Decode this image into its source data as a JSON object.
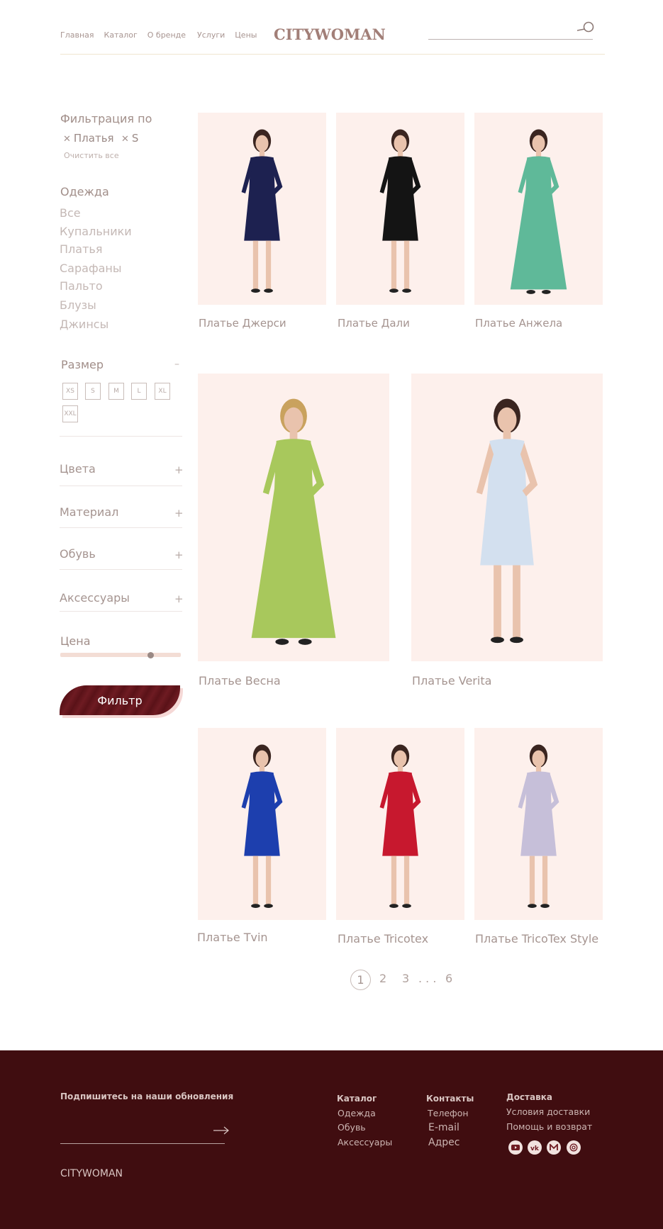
{
  "header": {
    "nav": [
      "Главная",
      "Каталог",
      "О бренде",
      "Услуги",
      "Цены"
    ],
    "logo": "CITYWOMAN"
  },
  "sidebar": {
    "filter_title": "Фильтрация по",
    "active_filters": [
      "Платья",
      "S"
    ],
    "clear_all": "Очистить все",
    "clothing_title": "Одежда",
    "clothing_items": [
      "Все",
      "Купальники",
      "Платья",
      "Сарафаны",
      "Пальто",
      "Блузы",
      "Джинсы"
    ],
    "size_title": "Размер",
    "sizes": [
      "XS",
      "S",
      "M",
      "L",
      "XL",
      "XXL"
    ],
    "accordions": [
      "Цвета",
      "Материал",
      "Обувь",
      "Аксессуары"
    ],
    "price_title": "Цена",
    "price_slider_position": 0.75,
    "filter_button": "Фильтр"
  },
  "products": [
    {
      "name": "Платье Джерси",
      "dress_color": "#1d2150"
    },
    {
      "name": "Платье Дали",
      "dress_color": "#141414"
    },
    {
      "name": "Платье Анжела",
      "dress_color": "#5fb999"
    },
    {
      "name": "Платье Весна",
      "dress_color": "#a8c85c"
    },
    {
      "name": "Платье Verita",
      "dress_color": "#d3e0ef"
    },
    {
      "name": "Платье Tvin",
      "dress_color": "#1d3fae"
    },
    {
      "name": "Платье Tricotex",
      "dress_color": "#c7182e"
    },
    {
      "name": "Платье TricoTex Style",
      "dress_color": "#c6bfd9"
    }
  ],
  "pagination": {
    "current": "1",
    "pages": [
      "2",
      "3"
    ],
    "ellipsis": ". . .",
    "last": "6"
  },
  "footer": {
    "subscribe_label": "Подпишитесь на наши обновления",
    "logo": "CITYWOMAN",
    "columns": [
      {
        "title": "Каталог",
        "items": [
          "Одежда",
          "Обувь",
          "Аксессуары"
        ]
      },
      {
        "title": "Контакты",
        "items": [
          "Телефон",
          "E-mail",
          "Адрес"
        ]
      },
      {
        "title": "Доставка",
        "items": [
          "Условия доставки",
          "Помощь и возврат"
        ]
      }
    ],
    "social_icons": [
      "youtube-icon",
      "vk-icon",
      "mail-icon",
      "at-icon"
    ]
  },
  "colors": {
    "accent": "#400d10",
    "brand": "#a27f78",
    "photo_bg": "#fdf0ec"
  }
}
